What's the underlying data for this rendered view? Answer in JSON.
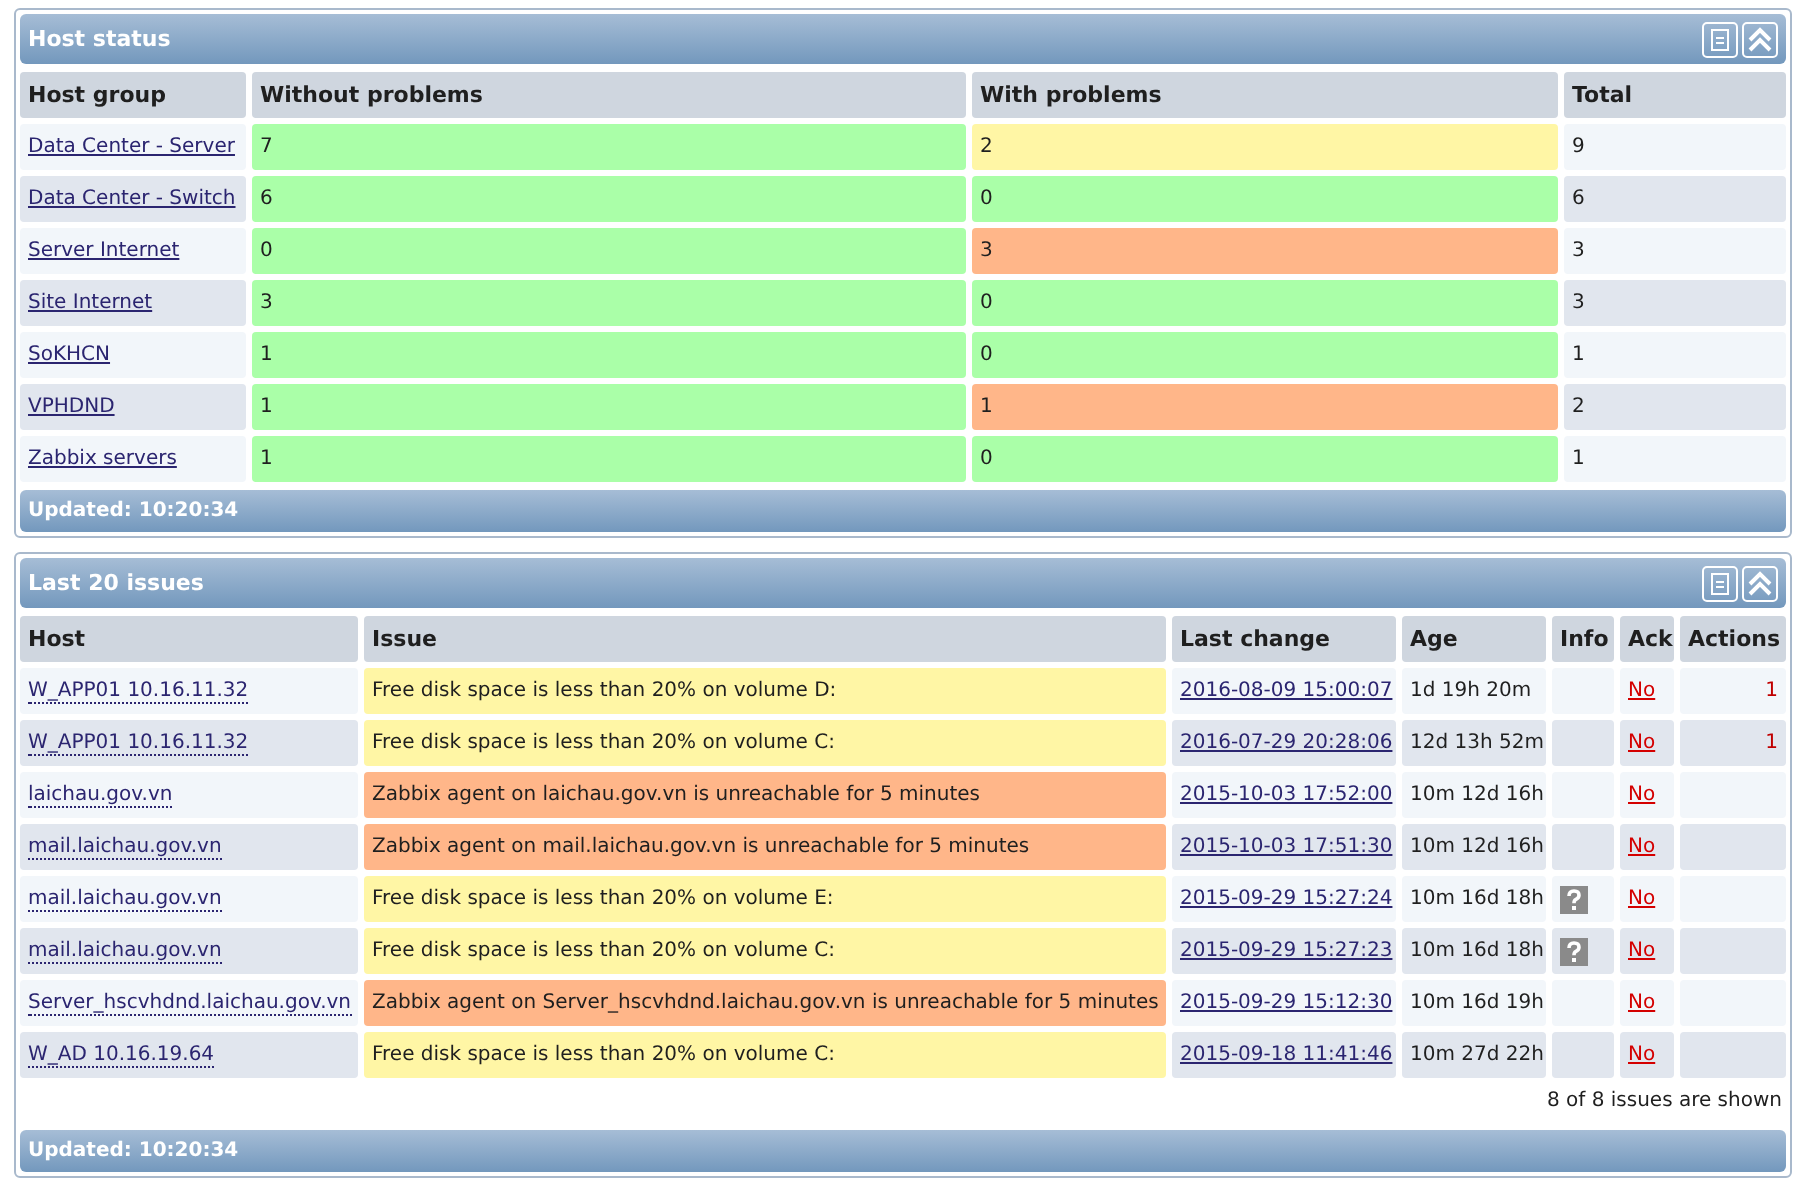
{
  "host_status": {
    "title": "Host status",
    "columns": [
      "Host group",
      "Without problems",
      "With problems",
      "Total"
    ],
    "rows": [
      {
        "group": "Data Center - Server",
        "without_problems": "7",
        "with_problems": "2",
        "color": "#fff6a5",
        "total": "9"
      },
      {
        "group": "Data Center - Switch",
        "without_problems": "6",
        "with_problems": "0",
        "color": "#aaffa8",
        "total": "6"
      },
      {
        "group": "Server Internet",
        "without_problems": "0",
        "with_problems": "3",
        "color": "#ffb689",
        "total": "3"
      },
      {
        "group": "Site Internet",
        "without_problems": "3",
        "with_problems": "0",
        "color": "#aaffa8",
        "total": "3"
      },
      {
        "group": "SoKHCN",
        "without_problems": "1",
        "with_problems": "0",
        "color": "#aaffa8",
        "total": "1"
      },
      {
        "group": "VPHDND",
        "without_problems": "1",
        "with_problems": "1",
        "color": "#ffb689",
        "total": "2"
      },
      {
        "group": "Zabbix servers",
        "without_problems": "1",
        "with_problems": "0",
        "color": "#aaffa8",
        "total": "1"
      }
    ],
    "footer": "Updated: 10:20:34"
  },
  "last_issues": {
    "title": "Last 20 issues",
    "columns": [
      "Host",
      "Issue",
      "Last change",
      "Age",
      "Info",
      "Ack",
      "Actions"
    ],
    "rows": [
      {
        "host": "W_APP01 10.16.11.32",
        "issue": "Free disk space is less than 20% on volume D:",
        "color": "#fff6a5",
        "last_change": "2016-08-09 15:00:07",
        "age": "1d 19h 20m",
        "info": false,
        "ack": "No",
        "actions": "1"
      },
      {
        "host": "W_APP01 10.16.11.32",
        "issue": "Free disk space is less than 20% on volume C:",
        "color": "#fff6a5",
        "last_change": "2016-07-29 20:28:06",
        "age": "12d 13h 52m",
        "info": false,
        "ack": "No",
        "actions": "1"
      },
      {
        "host": "laichau.gov.vn",
        "issue": "Zabbix agent on laichau.gov.vn is unreachable for 5 minutes",
        "color": "#ffb689",
        "last_change": "2015-10-03 17:52:00",
        "age": "10m 12d 16h",
        "info": false,
        "ack": "No"
      },
      {
        "host": "mail.laichau.gov.vn",
        "issue": "Zabbix agent on mail.laichau.gov.vn is unreachable for 5 minutes",
        "color": "#ffb689",
        "last_change": "2015-10-03 17:51:30",
        "age": "10m 12d 16h",
        "info": false,
        "ack": "No"
      },
      {
        "host": "mail.laichau.gov.vn",
        "issue": "Free disk space is less than 20% on volume E:",
        "color": "#fff6a5",
        "last_change": "2015-09-29 15:27:24",
        "age": "10m 16d 18h",
        "info": true,
        "ack": "No"
      },
      {
        "host": "mail.laichau.gov.vn",
        "issue": "Free disk space is less than 20% on volume C:",
        "color": "#fff6a5",
        "last_change": "2015-09-29 15:27:23",
        "age": "10m 16d 18h",
        "info": true,
        "ack": "No"
      },
      {
        "host": "Server_hscvhdnd.laichau.gov.vn",
        "issue": "Zabbix agent on Server_hscvhdnd.laichau.gov.vn is unreachable for 5 minutes",
        "color": "#ffb689",
        "last_change": "2015-09-29 15:12:30",
        "age": "10m 16d 19h",
        "info": false,
        "ack": "No"
      },
      {
        "host": "W_AD 10.16.19.64",
        "issue": "Free disk space is less than 20% on volume C:",
        "color": "#fff6a5",
        "last_change": "2015-09-18 11:41:46",
        "age": "10m 27d 22h",
        "info": false,
        "ack": "No"
      }
    ],
    "summary": "8 of 8 issues are shown",
    "footer": "Updated: 10:20:34"
  }
}
